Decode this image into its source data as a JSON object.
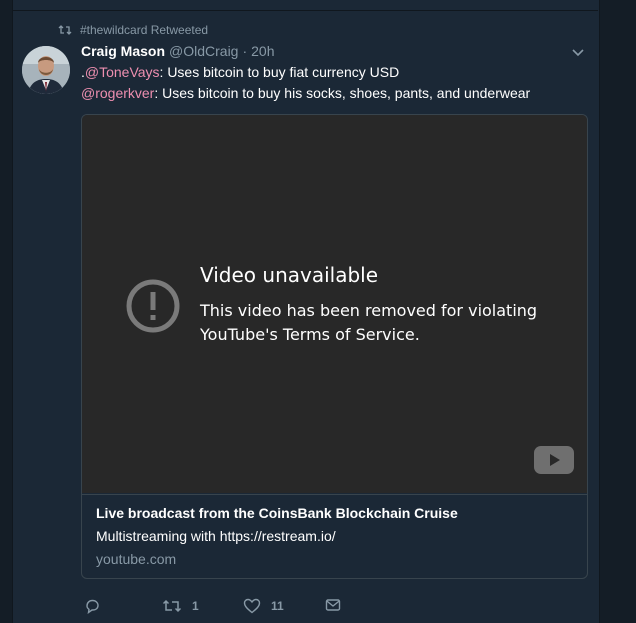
{
  "context": {
    "icon": "retweet-icon",
    "text": "#thewildcard Retweeted"
  },
  "tweet": {
    "author_name": "Craig Mason",
    "author_handle": "@OldCraig",
    "separator": "·",
    "time": "20h",
    "lines": [
      {
        "prefix": ".",
        "mention": "@ToneVays",
        "rest": ": Uses bitcoin to buy fiat currency USD"
      },
      {
        "prefix": "",
        "mention": "@rogerkver",
        "rest": ": Uses bitcoin to buy his socks, shoes, pants, and underwear"
      }
    ]
  },
  "card": {
    "player": {
      "title": "Video unavailable",
      "message": "This video has been removed for violating YouTube's Terms of Service."
    },
    "title": "Live broadcast from the CoinsBank Blockchain Cruise",
    "description": "Multistreaming with https://restream.io/",
    "domain": "youtube.com"
  },
  "actions": {
    "reply": {
      "icon": "reply-icon",
      "count": ""
    },
    "retweet": {
      "icon": "retweet-icon",
      "count": "1"
    },
    "like": {
      "icon": "heart-icon",
      "count": "11"
    },
    "dm": {
      "icon": "envelope-icon",
      "count": ""
    }
  },
  "colors": {
    "background": "#141d26",
    "column": "#1b2836",
    "muted": "#8899a6",
    "mention": "#ee8fb0",
    "player": "#282828"
  }
}
